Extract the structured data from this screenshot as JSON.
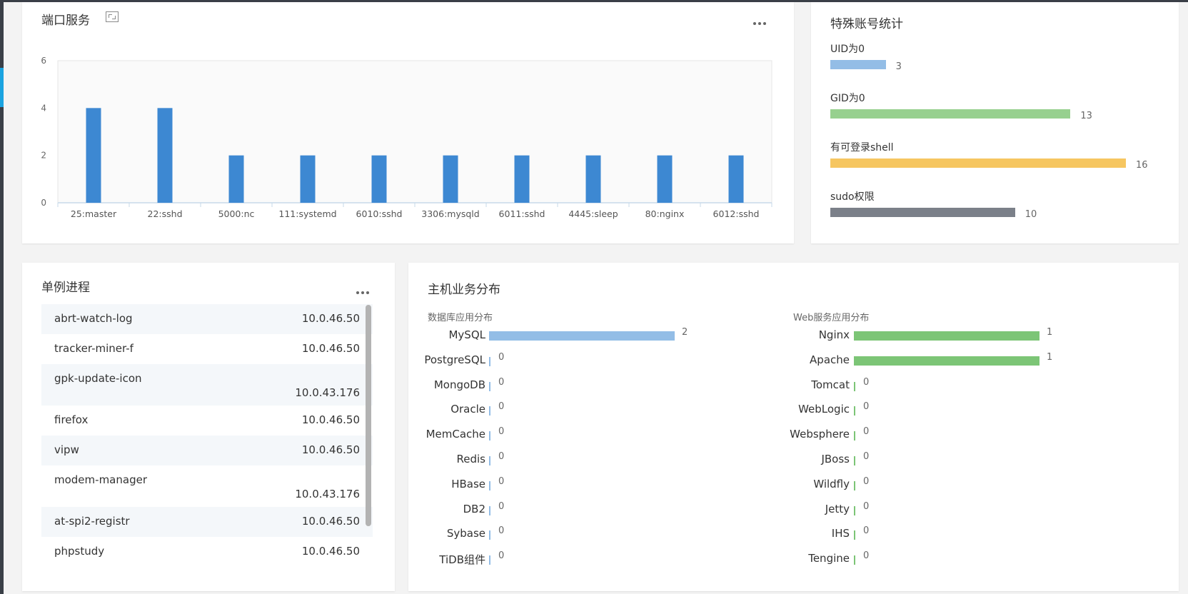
{
  "port_card": {
    "title": "端口服务",
    "chart_data": {
      "type": "bar",
      "categories": [
        "25:master",
        "22:sshd",
        "5000:nc",
        "111:systemd",
        "6010:sshd",
        "3306:mysqld",
        "6011:sshd",
        "4445:sleep",
        "80:nginx",
        "6012:sshd"
      ],
      "values": [
        4,
        4,
        2,
        2,
        2,
        2,
        2,
        2,
        2,
        2
      ],
      "ylim": [
        0,
        6
      ],
      "yticks": [
        0,
        2,
        4,
        6
      ],
      "bar_color": "#3d88d2",
      "grid": false
    }
  },
  "accounts_card": {
    "title": "特殊账号统计",
    "items": [
      {
        "label": "UID为0",
        "value": 3,
        "color": "#93bde6"
      },
      {
        "label": "GID为0",
        "value": 13,
        "color": "#97d08f"
      },
      {
        "label": "有可登录shell",
        "value": 16,
        "color": "#f6c660"
      },
      {
        "label": "sudo权限",
        "value": 10,
        "color": "#7b8089"
      }
    ]
  },
  "process_card": {
    "title": "单例进程",
    "rows": [
      {
        "name": "abrt-watch-log",
        "ip": "10.0.46.50"
      },
      {
        "name": "tracker-miner-f",
        "ip": "10.0.46.50"
      },
      {
        "name": "gpk-update-icon",
        "ip": "10.0.43.176"
      },
      {
        "name": "firefox",
        "ip": "10.0.46.50"
      },
      {
        "name": "vipw",
        "ip": "10.0.46.50"
      },
      {
        "name": "modem-manager",
        "ip": "10.0.43.176"
      },
      {
        "name": "at-spi2-registr",
        "ip": "10.0.46.50"
      },
      {
        "name": "phpstudy",
        "ip": "10.0.46.50"
      }
    ]
  },
  "business_card": {
    "title": "主机业务分布",
    "db": {
      "subtitle": "数据库应用分布",
      "color": "#93bde6",
      "items": [
        {
          "label": "MySQL",
          "value": 2
        },
        {
          "label": "PostgreSQL",
          "value": 0
        },
        {
          "label": "MongoDB",
          "value": 0
        },
        {
          "label": "Oracle",
          "value": 0
        },
        {
          "label": "MemCache",
          "value": 0
        },
        {
          "label": "Redis",
          "value": 0
        },
        {
          "label": "HBase",
          "value": 0
        },
        {
          "label": "DB2",
          "value": 0
        },
        {
          "label": "Sybase",
          "value": 0
        },
        {
          "label": "TiDB组件",
          "value": 0
        }
      ]
    },
    "web": {
      "subtitle": "Web服务应用分布",
      "color": "#7cc576",
      "items": [
        {
          "label": "Nginx",
          "value": 1
        },
        {
          "label": "Apache",
          "value": 1
        },
        {
          "label": "Tomcat",
          "value": 0
        },
        {
          "label": "WebLogic",
          "value": 0
        },
        {
          "label": "Websphere",
          "value": 0
        },
        {
          "label": "JBoss",
          "value": 0
        },
        {
          "label": "Wildfly",
          "value": 0
        },
        {
          "label": "Jetty",
          "value": 0
        },
        {
          "label": "IHS",
          "value": 0
        },
        {
          "label": "Tengine",
          "value": 0
        }
      ]
    }
  }
}
